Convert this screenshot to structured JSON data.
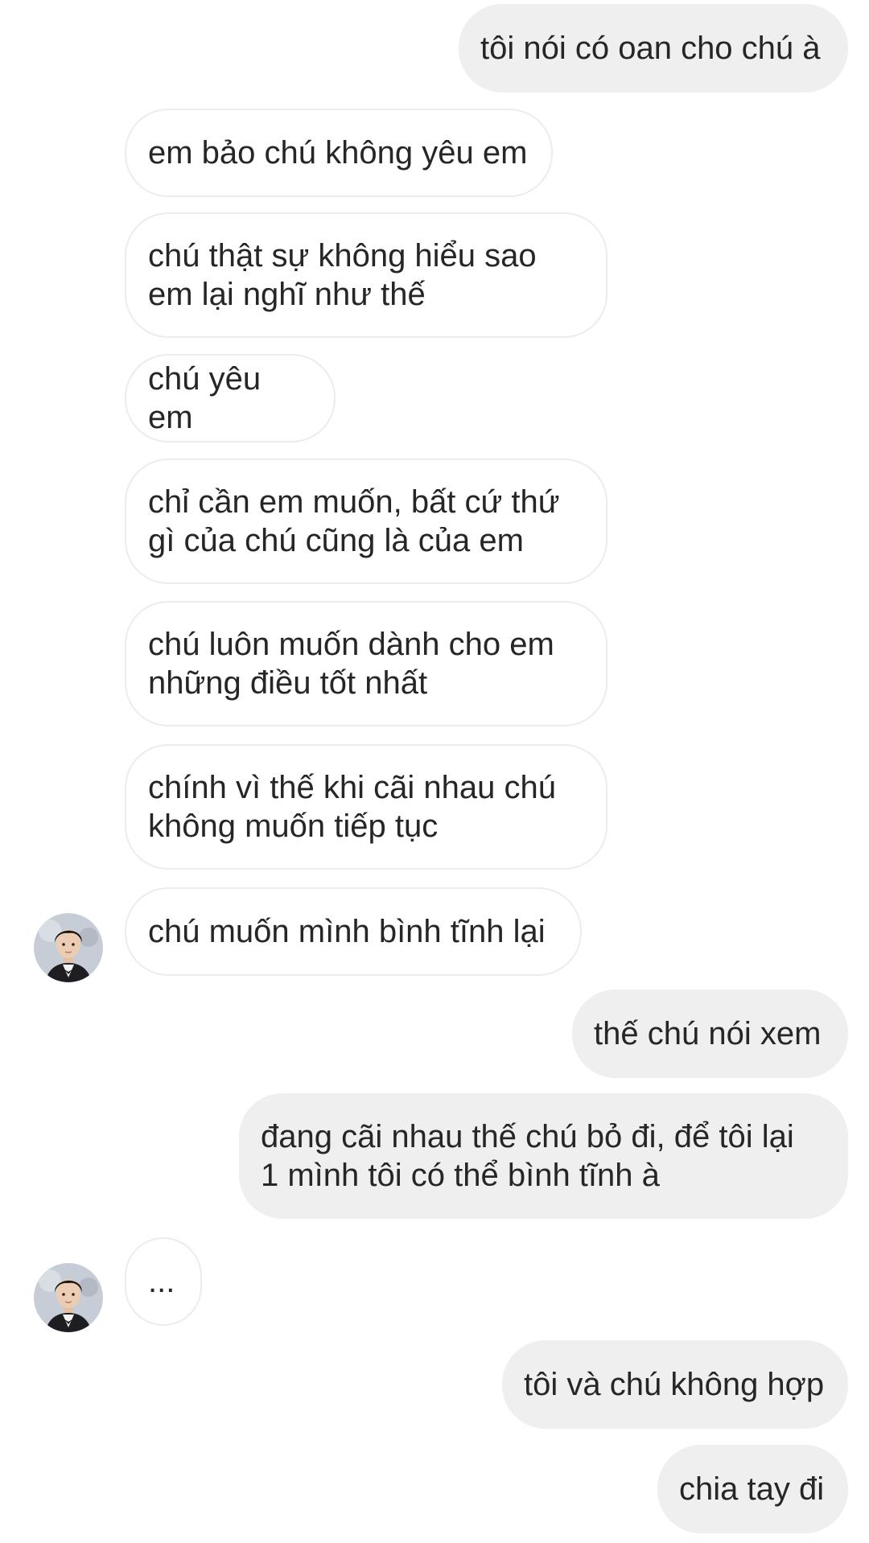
{
  "messages": [
    {
      "side": "sent",
      "text": "tôi nói có oan cho chú à"
    },
    {
      "side": "received",
      "text": "em bảo chú không yêu em"
    },
    {
      "side": "received",
      "text": "chú thật sự không hiểu sao\nem lại nghĩ như thế"
    },
    {
      "side": "received",
      "text": "chú yêu em"
    },
    {
      "side": "received",
      "text": "chỉ cần em muốn, bất cứ thứ\ngì của chú cũng là của em"
    },
    {
      "side": "received",
      "text": "chú luôn muốn dành cho em\nnhững điều tốt nhất"
    },
    {
      "side": "received",
      "text": "chính vì thế khi cãi nhau chú\nkhông muốn tiếp tục"
    },
    {
      "side": "received",
      "text": "chú muốn mình bình tĩnh lại",
      "avatar": "profile-photo"
    },
    {
      "side": "sent",
      "text": "thế chú nói xem"
    },
    {
      "side": "sent",
      "text": "đang cãi nhau thế chú bỏ đi, để tôi lại\n1 mình tôi có thể bình tĩnh à"
    },
    {
      "side": "received",
      "text": "...",
      "avatar": "profile-photo"
    },
    {
      "side": "sent",
      "text": "tôi và chú không hợp"
    },
    {
      "side": "sent",
      "text": "chia tay đi"
    }
  ],
  "colors": {
    "sent_bubble": "#efefef",
    "received_bubble": "#ffffff",
    "received_border": "#ececec",
    "text": "#262626"
  }
}
